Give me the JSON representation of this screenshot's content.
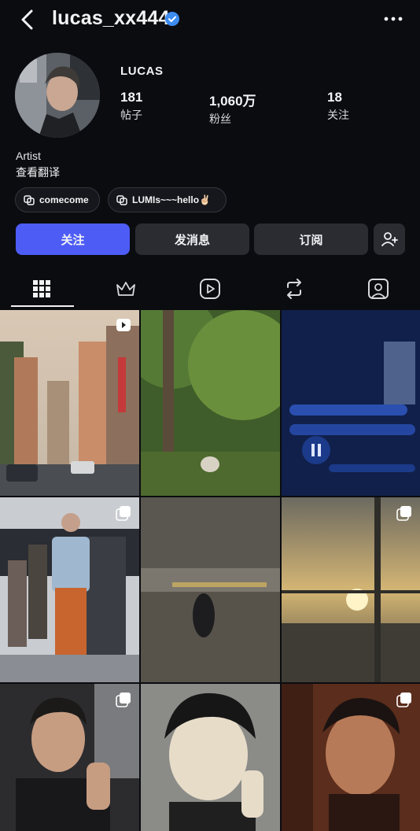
{
  "header": {
    "username": "lucas_xx444",
    "back_icon": "chevron-left-icon",
    "verified_icon": "verified-badge-icon",
    "more_icon": "more-horizontal-icon"
  },
  "profile": {
    "display_name": "LUCAS",
    "stats": [
      {
        "value": "181",
        "label": "帖子"
      },
      {
        "value": "1,060万",
        "label": "粉丝"
      },
      {
        "value": "18",
        "label": "关注"
      }
    ],
    "bio": "Artist",
    "translate_label": "查看翻译"
  },
  "chips": [
    {
      "icon": "threads-icon",
      "label": "comecome"
    },
    {
      "icon": "threads-icon",
      "label": "LUMIs~~~hello✌🏻"
    }
  ],
  "actions": {
    "follow_label": "关注",
    "message_label": "发消息",
    "subscribe_label": "订阅",
    "add_user_icon": "add-user-icon",
    "accent_color": "#4d5cf5"
  },
  "tabs": [
    {
      "name": "grid-icon",
      "active": true
    },
    {
      "name": "crown-icon",
      "active": false
    },
    {
      "name": "reels-icon",
      "active": false
    },
    {
      "name": "repost-icon",
      "active": false
    },
    {
      "name": "tagged-icon",
      "active": false
    }
  ],
  "posts": [
    {
      "subject": "city street",
      "badge": "video-icon"
    },
    {
      "subject": "forest",
      "badge": ""
    },
    {
      "subject": "phone screen music",
      "badge": ""
    },
    {
      "subject": "fashion runway",
      "badge": "carousel-icon"
    },
    {
      "subject": "motion blur street",
      "badge": ""
    },
    {
      "subject": "sunset fence",
      "badge": "carousel-icon"
    },
    {
      "subject": "selfie car",
      "badge": "carousel-icon"
    },
    {
      "subject": "illustration peace sign",
      "badge": ""
    },
    {
      "subject": "selfie warm",
      "badge": "carousel-icon"
    }
  ]
}
